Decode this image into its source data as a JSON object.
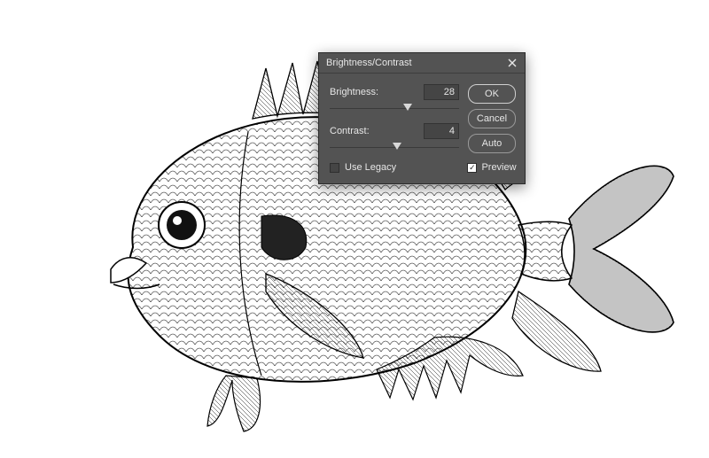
{
  "dialog": {
    "title": "Brightness/Contrast",
    "brightness_label": "Brightness:",
    "brightness_value": "28",
    "brightness_pos_pct": 60,
    "contrast_label": "Contrast:",
    "contrast_value": "4",
    "contrast_pos_pct": 52,
    "use_legacy_label": "Use Legacy",
    "use_legacy_checked": false,
    "ok_label": "OK",
    "cancel_label": "Cancel",
    "auto_label": "Auto",
    "preview_label": "Preview",
    "preview_checked": true
  },
  "artwork": {
    "description": "fish-illustration"
  }
}
